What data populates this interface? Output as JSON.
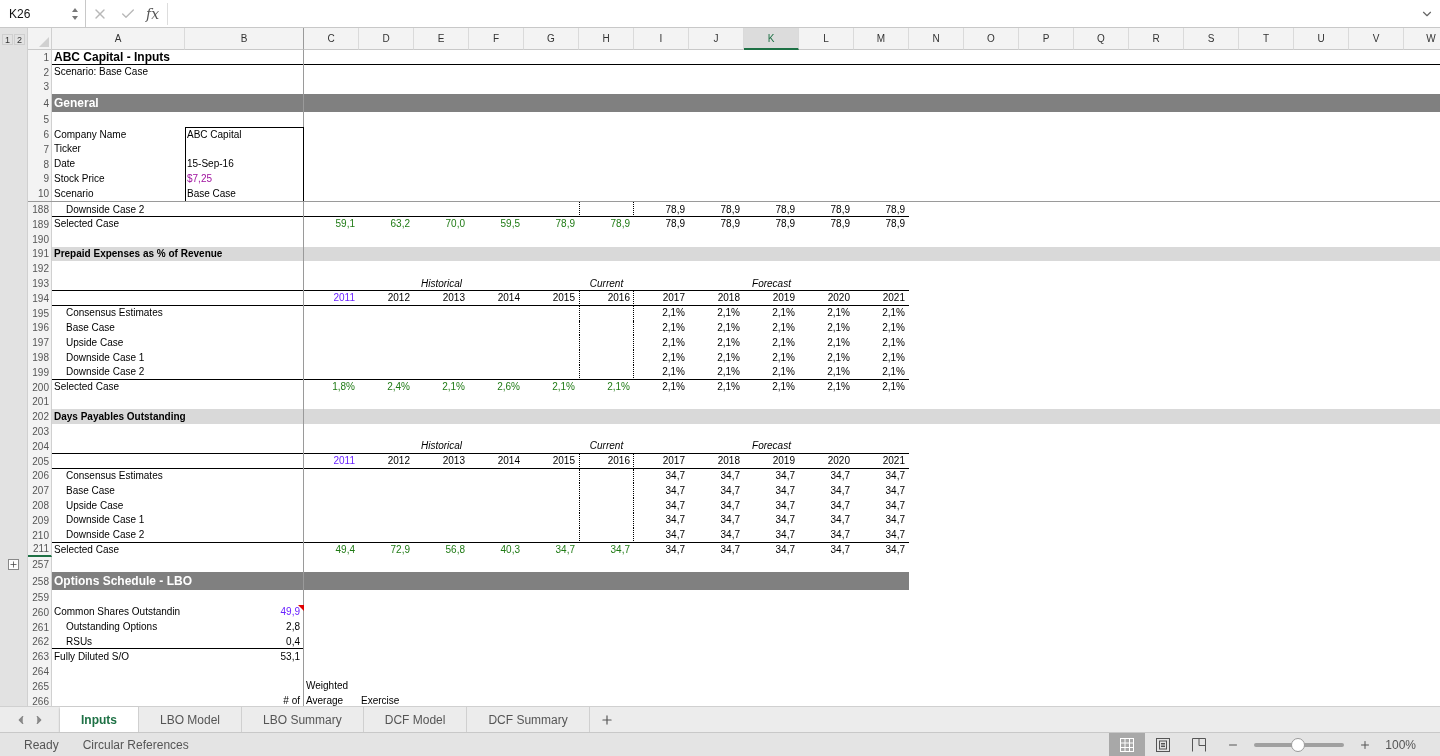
{
  "formula_bar": {
    "name_box": "K26",
    "function_label": "fx"
  },
  "outline_levels": [
    "1",
    "2"
  ],
  "columns": [
    {
      "label": "A",
      "selected": false
    },
    {
      "label": "B",
      "selected": false
    },
    {
      "label": "C",
      "selected": false
    },
    {
      "label": "D",
      "selected": false
    },
    {
      "label": "E",
      "selected": false
    },
    {
      "label": "F",
      "selected": false
    },
    {
      "label": "G",
      "selected": false
    },
    {
      "label": "H",
      "selected": false
    },
    {
      "label": "I",
      "selected": false
    },
    {
      "label": "J",
      "selected": false
    },
    {
      "label": "K",
      "selected": true
    },
    {
      "label": "L",
      "selected": false
    },
    {
      "label": "M",
      "selected": false
    },
    {
      "label": "N",
      "selected": false
    },
    {
      "label": "O",
      "selected": false
    },
    {
      "label": "P",
      "selected": false
    },
    {
      "label": "Q",
      "selected": false
    },
    {
      "label": "R",
      "selected": false
    },
    {
      "label": "S",
      "selected": false
    },
    {
      "label": "T",
      "selected": false
    },
    {
      "label": "U",
      "selected": false
    },
    {
      "label": "V",
      "selected": false
    },
    {
      "label": "W",
      "selected": false
    }
  ],
  "frozen_rows": [
    {
      "num": "1",
      "kind": "title",
      "label": "ABC Capital - Inputs",
      "underlined": true
    },
    {
      "num": "2",
      "kind": "text",
      "label": "Scenario: Base Case"
    },
    {
      "num": "3",
      "kind": "blank"
    },
    {
      "num": "4",
      "kind": "major_section",
      "label": "General",
      "full_width": true
    },
    {
      "num": "5",
      "kind": "blank"
    },
    {
      "num": "6",
      "kind": "field",
      "label": "Company Name",
      "boxed": true,
      "b": {
        "text": "ABC Capital",
        "kind": "plain"
      }
    },
    {
      "num": "7",
      "kind": "field",
      "label": "Ticker",
      "boxed": true
    },
    {
      "num": "8",
      "kind": "field",
      "label": "Date",
      "boxed": true,
      "b": {
        "text": "15-Sep-16",
        "kind": "plain"
      }
    },
    {
      "num": "9",
      "kind": "field",
      "label": "Stock Price",
      "boxed": true,
      "b": {
        "text": "$7,25",
        "kind": "cross_link"
      }
    },
    {
      "num": "10",
      "kind": "field",
      "label": "Scenario",
      "boxed": true,
      "b": {
        "text": "Base Case",
        "kind": "plain"
      }
    }
  ],
  "rows": [
    {
      "num": "188",
      "kind": "data",
      "label": "Downside Case 2",
      "indent": true,
      "underlined": true,
      "forecast": [
        "78,9",
        "78,9",
        "78,9",
        "78,9",
        "78,9"
      ]
    },
    {
      "num": "189",
      "kind": "data",
      "label": "Selected Case",
      "indent": false,
      "historical": [
        {
          "text": "59,1",
          "kind": "link"
        },
        {
          "text": "63,2",
          "kind": "link"
        },
        {
          "text": "70,0",
          "kind": "link"
        },
        {
          "text": "59,5",
          "kind": "link"
        },
        {
          "text": "78,9",
          "kind": "link"
        },
        {
          "text": "78,9",
          "kind": "link"
        }
      ],
      "forecast": [
        "78,9",
        "78,9",
        "78,9",
        "78,9",
        "78,9"
      ]
    },
    {
      "num": "190",
      "kind": "blank"
    },
    {
      "num": "191",
      "kind": "minor_section",
      "label": "Prepaid Expenses as % of Revenue",
      "full_width": true
    },
    {
      "num": "192",
      "kind": "blank"
    },
    {
      "num": "193",
      "kind": "groups",
      "underlined": true,
      "groups": [
        "Historical",
        "Current",
        "Forecast"
      ]
    },
    {
      "num": "194",
      "kind": "years",
      "underlined": true,
      "years": [
        {
          "text": "2011",
          "kind": "input"
        },
        {
          "text": "2012",
          "kind": "plain"
        },
        {
          "text": "2013",
          "kind": "plain"
        },
        {
          "text": "2014",
          "kind": "plain"
        },
        {
          "text": "2015",
          "kind": "plain"
        },
        {
          "text": "2016",
          "kind": "plain"
        },
        {
          "text": "2017",
          "kind": "plain"
        },
        {
          "text": "2018",
          "kind": "plain"
        },
        {
          "text": "2019",
          "kind": "plain"
        },
        {
          "text": "2020",
          "kind": "plain"
        },
        {
          "text": "2021",
          "kind": "plain"
        }
      ]
    },
    {
      "num": "195",
      "kind": "data",
      "label": "Consensus Estimates",
      "indent": true,
      "forecast": [
        "2,1%",
        "2,1%",
        "2,1%",
        "2,1%",
        "2,1%"
      ]
    },
    {
      "num": "196",
      "kind": "data",
      "label": "Base Case",
      "indent": true,
      "forecast": [
        "2,1%",
        "2,1%",
        "2,1%",
        "2,1%",
        "2,1%"
      ]
    },
    {
      "num": "197",
      "kind": "data",
      "label": "Upside Case",
      "indent": true,
      "forecast": [
        "2,1%",
        "2,1%",
        "2,1%",
        "2,1%",
        "2,1%"
      ]
    },
    {
      "num": "198",
      "kind": "data",
      "label": "Downside Case 1",
      "indent": true,
      "forecast": [
        "2,1%",
        "2,1%",
        "2,1%",
        "2,1%",
        "2,1%"
      ]
    },
    {
      "num": "199",
      "kind": "data",
      "label": "Downside Case 2",
      "indent": true,
      "underlined": true,
      "forecast": [
        "2,1%",
        "2,1%",
        "2,1%",
        "2,1%",
        "2,1%"
      ]
    },
    {
      "num": "200",
      "kind": "data",
      "label": "Selected Case",
      "indent": false,
      "historical": [
        {
          "text": "1,8%",
          "kind": "link"
        },
        {
          "text": "2,4%",
          "kind": "link"
        },
        {
          "text": "2,1%",
          "kind": "link"
        },
        {
          "text": "2,6%",
          "kind": "link"
        },
        {
          "text": "2,1%",
          "kind": "link"
        },
        {
          "text": "2,1%",
          "kind": "link"
        }
      ],
      "forecast": [
        "2,1%",
        "2,1%",
        "2,1%",
        "2,1%",
        "2,1%"
      ]
    },
    {
      "num": "201",
      "kind": "blank"
    },
    {
      "num": "202",
      "kind": "minor_section",
      "label": "Days Payables Outstanding",
      "full_width": true
    },
    {
      "num": "203",
      "kind": "blank"
    },
    {
      "num": "204",
      "kind": "groups",
      "underlined": true,
      "groups": [
        "Historical",
        "Current",
        "Forecast"
      ]
    },
    {
      "num": "205",
      "kind": "years",
      "underlined": true,
      "years": [
        {
          "text": "2011",
          "kind": "input"
        },
        {
          "text": "2012",
          "kind": "plain"
        },
        {
          "text": "2013",
          "kind": "plain"
        },
        {
          "text": "2014",
          "kind": "plain"
        },
        {
          "text": "2015",
          "kind": "plain"
        },
        {
          "text": "2016",
          "kind": "plain"
        },
        {
          "text": "2017",
          "kind": "plain"
        },
        {
          "text": "2018",
          "kind": "plain"
        },
        {
          "text": "2019",
          "kind": "plain"
        },
        {
          "text": "2020",
          "kind": "plain"
        },
        {
          "text": "2021",
          "kind": "plain"
        }
      ]
    },
    {
      "num": "206",
      "kind": "data",
      "label": "Consensus Estimates",
      "indent": true,
      "forecast": [
        "34,7",
        "34,7",
        "34,7",
        "34,7",
        "34,7"
      ]
    },
    {
      "num": "207",
      "kind": "data",
      "label": "Base Case",
      "indent": true,
      "forecast": [
        "34,7",
        "34,7",
        "34,7",
        "34,7",
        "34,7"
      ]
    },
    {
      "num": "208",
      "kind": "data",
      "label": "Upside Case",
      "indent": true,
      "forecast": [
        "34,7",
        "34,7",
        "34,7",
        "34,7",
        "34,7"
      ]
    },
    {
      "num": "209",
      "kind": "data",
      "label": "Downside Case 1",
      "indent": true,
      "forecast": [
        "34,7",
        "34,7",
        "34,7",
        "34,7",
        "34,7"
      ]
    },
    {
      "num": "210",
      "kind": "data",
      "label": "Downside Case 2",
      "indent": true,
      "underlined": true,
      "forecast": [
        "34,7",
        "34,7",
        "34,7",
        "34,7",
        "34,7"
      ]
    },
    {
      "num": "211",
      "kind": "data",
      "label": "Selected Case",
      "indent": false,
      "hidden_rows_below": true,
      "historical": [
        {
          "text": "49,4",
          "kind": "link"
        },
        {
          "text": "72,9",
          "kind": "link"
        },
        {
          "text": "56,8",
          "kind": "link"
        },
        {
          "text": "40,3",
          "kind": "link"
        },
        {
          "text": "34,7",
          "kind": "link"
        },
        {
          "text": "34,7",
          "kind": "link"
        }
      ],
      "forecast": [
        "34,7",
        "34,7",
        "34,7",
        "34,7",
        "34,7"
      ]
    },
    {
      "num": "257",
      "kind": "blank",
      "outline_button": true
    },
    {
      "num": "258",
      "kind": "major_section",
      "label": "Options Schedule - LBO",
      "full_width": false
    },
    {
      "num": "259",
      "kind": "blank"
    },
    {
      "num": "260",
      "kind": "field",
      "label": "Common Shares Outstandin",
      "comment": true,
      "b": {
        "text": "49,9",
        "kind": "input"
      }
    },
    {
      "num": "261",
      "kind": "field",
      "label": "Outstanding Options",
      "indent": true,
      "b": {
        "text": "2,8",
        "kind": "plain"
      }
    },
    {
      "num": "262",
      "kind": "field",
      "label": "RSUs",
      "indent": true,
      "underlined": true,
      "b": {
        "text": "0,4",
        "kind": "plain"
      }
    },
    {
      "num": "263",
      "kind": "field",
      "label": "Fully Diluted S/O",
      "b": {
        "text": "53,1",
        "kind": "plain"
      }
    },
    {
      "num": "264",
      "kind": "blank"
    },
    {
      "num": "265",
      "kind": "field",
      "c": "Weighted"
    },
    {
      "num": "266",
      "kind": "field",
      "b": {
        "text": "# of",
        "kind": "plain"
      },
      "c": "Average",
      "d": "Exercise"
    }
  ],
  "sheet_tabs": [
    {
      "label": "Inputs",
      "selected": true
    },
    {
      "label": "LBO Model",
      "selected": false
    },
    {
      "label": "LBO Summary",
      "selected": false
    },
    {
      "label": "DCF Model",
      "selected": false
    },
    {
      "label": "DCF Summary",
      "selected": false
    }
  ],
  "status_bar": {
    "items": [
      "Ready",
      "Circular References"
    ],
    "views": [
      {
        "selected": true
      },
      {
        "selected": false
      },
      {
        "selected": false
      }
    ],
    "zoom": {
      "level": 0.49,
      "reading": "100%"
    }
  }
}
